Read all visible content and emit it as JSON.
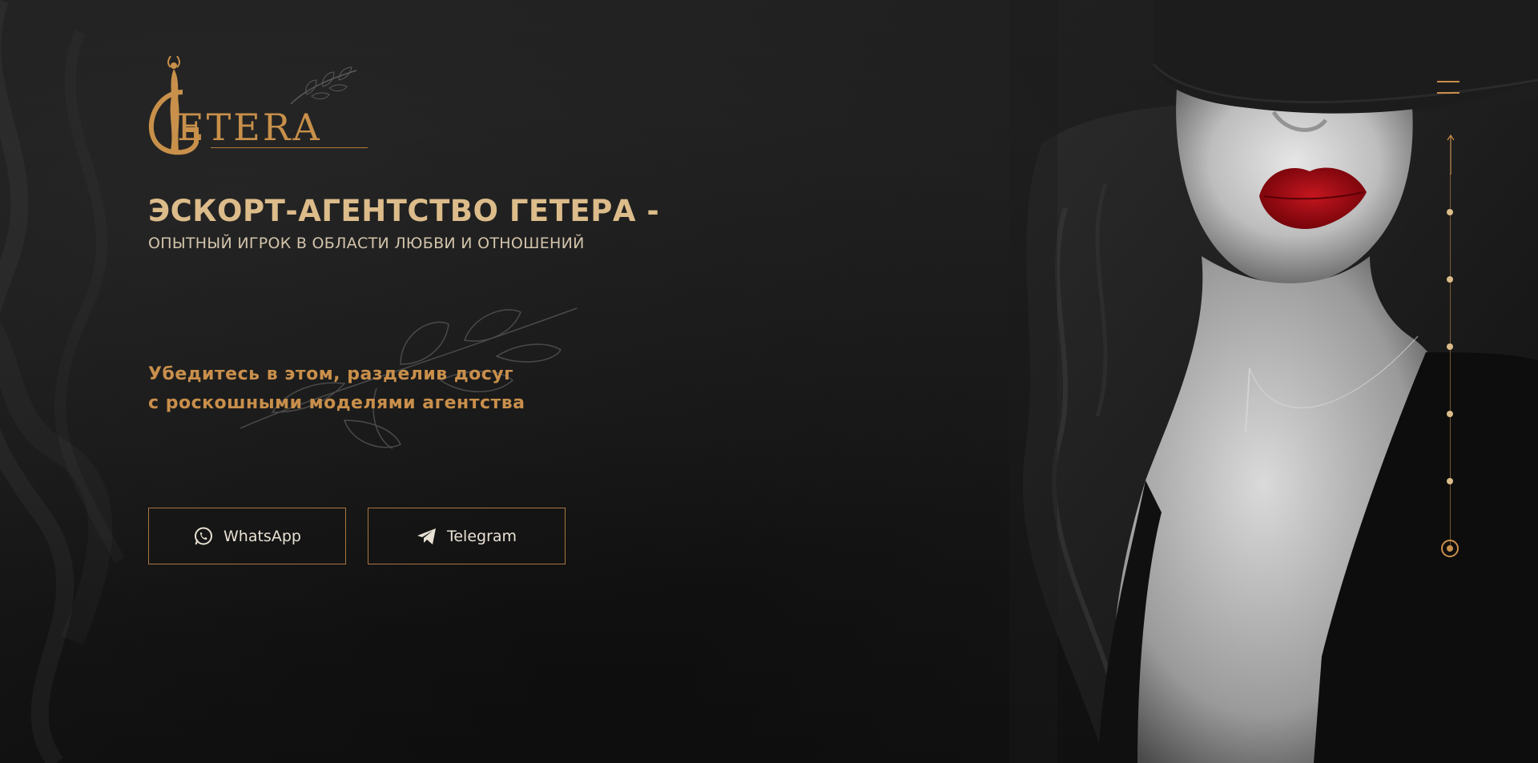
{
  "colors": {
    "accent": "#c98f4b",
    "headline": "#dcbc8a",
    "background": "#1b1b1b",
    "lips": "#9e0a12"
  },
  "logo": {
    "text": "ETERA",
    "initial": "G",
    "icon": "dancer-figure-logo"
  },
  "hero": {
    "headline": "ЭСКОРТ-АГЕНТСТВО ГЕТЕРА -",
    "subheadline": "ОПЫТНЫЙ ИГРОК В ОБЛАСТИ ЛЮБВИ И ОТНОШЕНИЙ",
    "tagline_line1": "Убедитесь в этом, разделив досуг",
    "tagline_line2": "с роскошными моделями агентства"
  },
  "buttons": {
    "whatsapp": {
      "label": "WhatsApp",
      "icon": "whatsapp-icon"
    },
    "telegram": {
      "label": "Telegram",
      "icon": "telegram-icon"
    }
  },
  "nav": {
    "menu_icon": "hamburger-icon",
    "up_icon": "arrow-up-icon",
    "slides": 6,
    "active_slide": 6
  }
}
